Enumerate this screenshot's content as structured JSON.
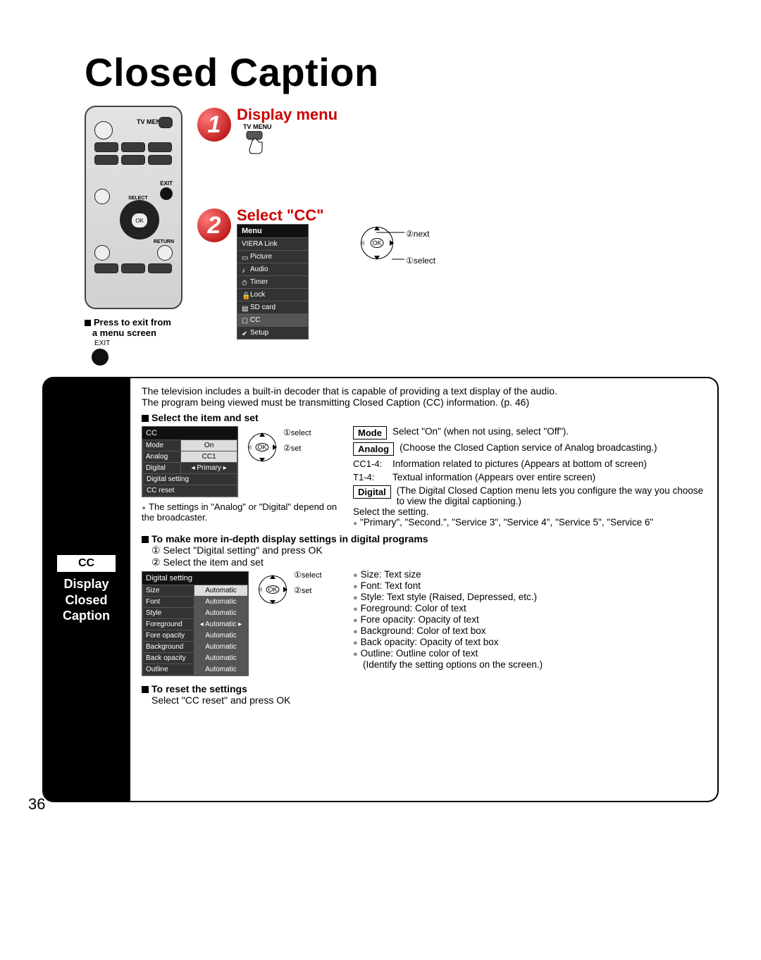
{
  "page_number": "36",
  "title": "Closed Caption",
  "steps": {
    "s1": {
      "label": "Display menu",
      "sublabel": "TV MENU"
    },
    "s2": {
      "label": "Select \"CC\""
    }
  },
  "remote": {
    "tv_menu": "TV MENU",
    "exit": "EXIT",
    "select": "SELECT",
    "ok": "OK",
    "return": "RETURN"
  },
  "exit_note": {
    "l1": "Press to exit from",
    "l2": "a menu screen",
    "btn": "EXIT"
  },
  "menu": {
    "title": "Menu",
    "items": [
      "VIERA Link",
      "Picture",
      "Audio",
      "Timer",
      "Lock",
      "SD card",
      "CC",
      "Setup"
    ]
  },
  "nav_hints": {
    "next": "next",
    "select": "select",
    "set": "set",
    "ok": "OK",
    "n1": "①",
    "n2": "②"
  },
  "sidebar": {
    "badge": "CC",
    "l1": "Display",
    "l2": "Closed",
    "l3": "Caption"
  },
  "intro": {
    "p1": "The television includes a built-in decoder that is capable of providing a text display of the audio.",
    "p2": "The program being viewed must be transmitting Closed Caption (CC) information. (p. 46)"
  },
  "sec": {
    "select_set": "Select the item and set",
    "deep": "To make more in-depth display settings in digital programs",
    "deep1": "① Select \"Digital setting\" and press OK",
    "deep2": "② Select the item and set",
    "reset_h": "To reset the settings",
    "reset_t": "Select \"CC reset\" and press OK"
  },
  "cc_menu": {
    "title": "CC",
    "rows": [
      {
        "k": "Mode",
        "v": "On"
      },
      {
        "k": "Analog",
        "v": "CC1"
      },
      {
        "k": "Digital",
        "v": "Primary"
      }
    ],
    "extra": [
      "Digital setting",
      "CC reset"
    ]
  },
  "cc_note": "The settings in \"Analog\" or \"Digital\" depend on the broadcaster.",
  "defs": {
    "mode": {
      "tag": "Mode",
      "t": "Select \"On\" (when not using, select \"Off\")."
    },
    "analog": {
      "tag": "Analog",
      "t": "(Choose the Closed Caption service of Analog broadcasting.)"
    },
    "cc14": {
      "k": "CC1-4:",
      "t": "Information related to pictures (Appears at bottom of screen)"
    },
    "t14": {
      "k": "T1-4:",
      "t": "Textual information (Appears over entire screen)"
    },
    "digital": {
      "tag": "Digital",
      "t": "(The Digital Closed Caption menu lets you configure the way you choose to view the digital captioning.)"
    },
    "sel": "Select the setting.",
    "svc": "\"Primary\", \"Second.\", \"Service 3\", \"Service 4\", \"Service 5\", \"Service 6\""
  },
  "ds_menu": {
    "title": "Digital setting",
    "rows": [
      {
        "k": "Size",
        "v": "Automatic"
      },
      {
        "k": "Font",
        "v": "Automatic"
      },
      {
        "k": "Style",
        "v": "Automatic"
      },
      {
        "k": "Foreground",
        "v": "Automatic"
      },
      {
        "k": "Fore opacity",
        "v": "Automatic"
      },
      {
        "k": "Background",
        "v": "Automatic"
      },
      {
        "k": "Back opacity",
        "v": "Automatic"
      },
      {
        "k": "Outline",
        "v": "Automatic"
      }
    ]
  },
  "ds_list": [
    "Size:  Text size",
    "Font:  Text font",
    "Style:  Text style (Raised, Depressed, etc.)",
    "Foreground:  Color of text",
    "Fore opacity:  Opacity of text",
    "Background:  Color of text box",
    "Back opacity:  Opacity of text box",
    "Outline:  Outline color of text"
  ],
  "ds_list_note": "(Identify the setting options on the screen.)"
}
